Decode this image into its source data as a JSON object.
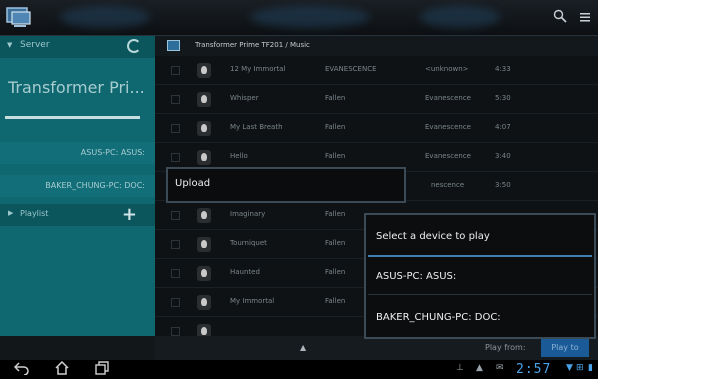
{
  "path": "Transformer Prime TF201 / Music",
  "sidebar": {
    "server_label": "Server",
    "title": "Transformer Pri...",
    "hosts": [
      "ASUS-PC: ASUS:",
      "BAKER_CHUNG-PC: DOC:"
    ],
    "playlist_label": "Playlist"
  },
  "tracks": [
    {
      "title": "12 My Immortal",
      "album": "EVANESCENCE",
      "artist": "<unknown>",
      "duration": "4:33"
    },
    {
      "title": "Whisper",
      "album": "Fallen",
      "artist": "Evanescence",
      "duration": "5:30"
    },
    {
      "title": "My Last Breath",
      "album": "Fallen",
      "artist": "Evanescence",
      "duration": "4:07"
    },
    {
      "title": "Hello",
      "album": "Fallen",
      "artist": "Evanescence",
      "duration": "3:40"
    },
    {
      "title": "",
      "album": "",
      "artist": "nescence",
      "duration": "3:50"
    },
    {
      "title": "Imaginary",
      "album": "Fallen",
      "artist": "",
      "duration": ""
    },
    {
      "title": "Tourniquet",
      "album": "Fallen",
      "artist": "",
      "duration": ""
    },
    {
      "title": "Haunted",
      "album": "Fallen",
      "artist": "",
      "duration": ""
    },
    {
      "title": "My Immortal",
      "album": "Fallen",
      "artist": "",
      "duration": ""
    },
    {
      "title": "",
      "album": "",
      "artist": "",
      "duration": ""
    }
  ],
  "upload_menu": {
    "label": "Upload"
  },
  "device_dialog": {
    "title": "Select a device to play",
    "options": [
      "ASUS-PC: ASUS:",
      "BAKER_CHUNG-PC: DOC:"
    ]
  },
  "bottom": {
    "play_from_label": "Play from:",
    "play_to_label": "Play to"
  },
  "status": {
    "time": "2:57"
  },
  "icons": {
    "app": "app-icon",
    "search": "search-icon",
    "menu": "overflow-menu-icon",
    "refresh": "refresh-icon",
    "add": "plus-icon",
    "back": "back-icon",
    "home": "home-icon",
    "recents": "recent-apps-icon"
  },
  "colors": {
    "sidebar": "#0f6770",
    "accent": "#3d7fb0",
    "clock": "#4aa3e8"
  }
}
